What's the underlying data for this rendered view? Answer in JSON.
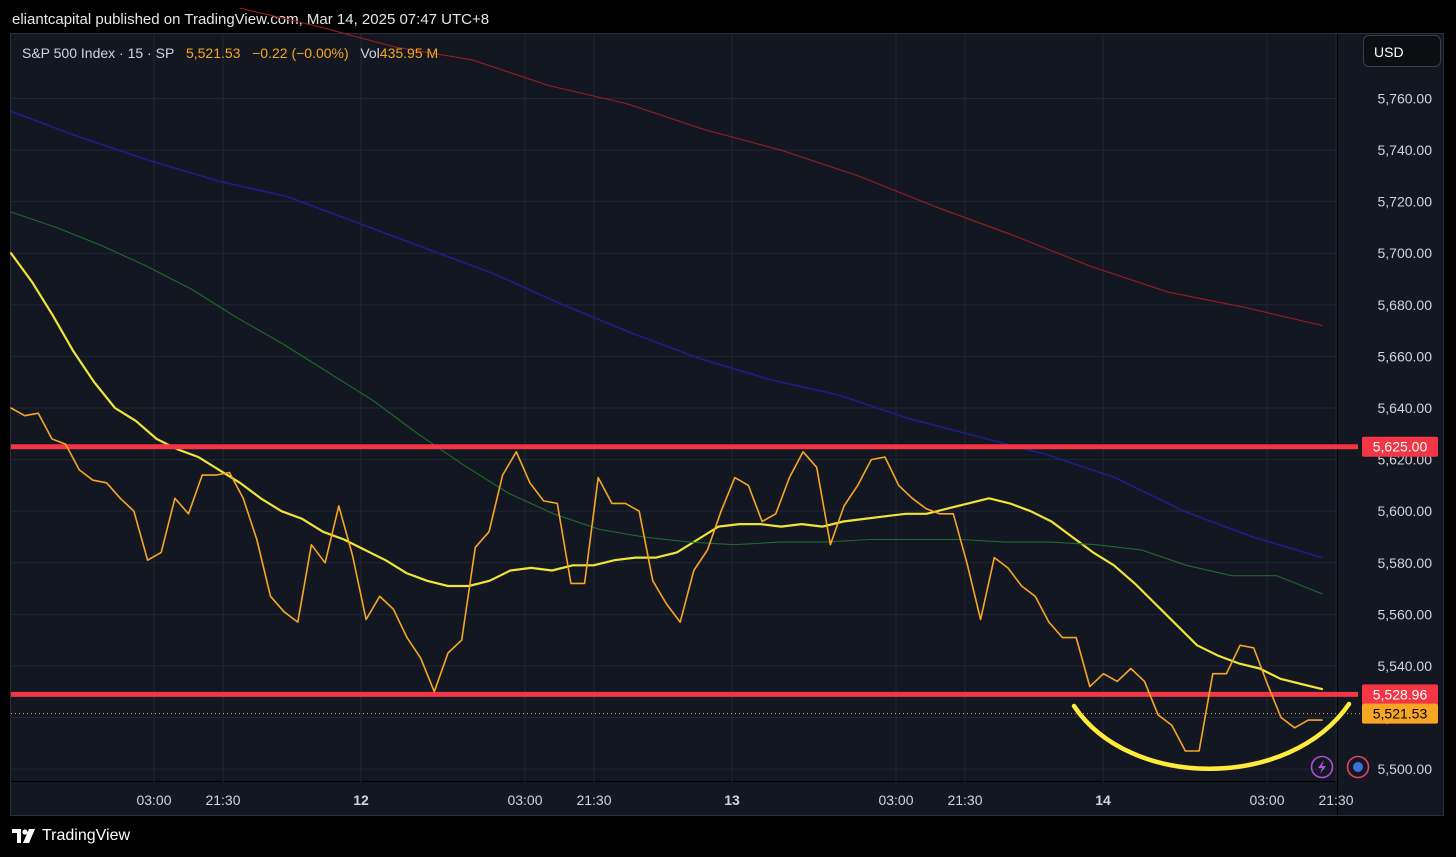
{
  "header": {
    "published_text": "eliantcapital published on TradingView.com, Mar 14, 2025 07:47 UTC+8"
  },
  "legend": {
    "symbol": "S&P 500 Index · 15 · SP",
    "last": "5,521.53",
    "change": "−0.22 (−0.00%)",
    "vol_label": "Vol",
    "vol_value": "435.95 M"
  },
  "currency_button": "USD",
  "footer": {
    "brand": "TradingView"
  },
  "colors": {
    "price": "#f6a623",
    "sma_yellow": "#f0e43a",
    "sma_green": "#1b6b2a",
    "sma_blue": "#1c1e8a",
    "sma_red": "#9b1d1d",
    "level": "#f23645",
    "annotation": "#ffeb3b"
  },
  "chart_data": {
    "type": "line",
    "x_ticks": [
      "03:00",
      "21:30",
      "12",
      "03:00",
      "21:30",
      "13",
      "03:00",
      "21:30",
      "14",
      "03:00",
      "21:30"
    ],
    "y_ticks": [
      "5,500.00",
      "5,520.00",
      "5,540.00",
      "5,560.00",
      "5,580.00",
      "5,600.00",
      "5,620.00",
      "5,640.00",
      "5,660.00",
      "5,680.00",
      "5,700.00",
      "5,720.00",
      "5,740.00",
      "5,760.00"
    ],
    "ylim": [
      5495,
      5785
    ],
    "grid": true,
    "horizontal_levels": [
      {
        "value": 5625.0,
        "label": "5,625.00"
      },
      {
        "value": 5528.96,
        "label": "5,528.96"
      }
    ],
    "last_price": {
      "value": 5521.53,
      "label": "5,521.53"
    },
    "series": [
      {
        "key": "price",
        "values": [
          5640,
          5637,
          5638,
          5628,
          5626,
          5616,
          5612,
          5611,
          5605,
          5600,
          5581,
          5584,
          5605,
          5599,
          5614,
          5614,
          5615,
          5605,
          5589,
          5567,
          5561,
          5557,
          5587,
          5580,
          5602,
          5583,
          5558,
          5567,
          5562,
          5551,
          5543,
          5530,
          5545,
          5550,
          5586,
          5592,
          5614,
          5623,
          5611,
          5604,
          5603,
          5572,
          5572,
          5613,
          5603,
          5603,
          5600,
          5573,
          5564,
          5557,
          5577,
          5585,
          5600,
          5613,
          5610,
          5596,
          5599,
          5613,
          5623,
          5617,
          5587,
          5602,
          5610,
          5620,
          5621,
          5610,
          5605,
          5601,
          5599,
          5599,
          5580,
          5558,
          5582,
          5578,
          5571,
          5567,
          5557,
          5551,
          5551,
          5532,
          5537,
          5534,
          5539,
          5534,
          5521,
          5517,
          5507,
          5507,
          5537,
          5537,
          5548,
          5547,
          5533,
          5520,
          5516,
          5519,
          5519
        ]
      },
      {
        "key": "sma_yellow",
        "values": [
          5700,
          5689,
          5676,
          5662,
          5650,
          5640,
          5635,
          5628,
          5624,
          5621,
          5616,
          5611,
          5605,
          5600,
          5597,
          5592,
          5589,
          5585,
          5581,
          5576,
          5573,
          5571,
          5571,
          5573,
          5577,
          5578,
          5577,
          5579,
          5579,
          5581,
          5582,
          5582,
          5584,
          5589,
          5594,
          5595,
          5595,
          5594,
          5595,
          5594,
          5596,
          5597,
          5598,
          5599,
          5599,
          5601,
          5603,
          5605,
          5603,
          5600,
          5596,
          5590,
          5584,
          5579,
          5572,
          5564,
          5556,
          5548,
          5544,
          5541,
          5539,
          5535,
          5533,
          5531
        ]
      },
      {
        "key": "sma_green",
        "values": [
          5716,
          5710,
          5703,
          5695,
          5686,
          5675,
          5665,
          5654,
          5643,
          5630,
          5618,
          5607,
          5599,
          5593,
          5590,
          5588,
          5587,
          5588,
          5588,
          5589,
          5589,
          5589,
          5588,
          5588,
          5587,
          5585,
          5579,
          5575,
          5575,
          5568
        ]
      },
      {
        "key": "sma_blue",
        "values": [
          5755,
          5745,
          5736,
          5728,
          5722,
          5712,
          5702,
          5692,
          5680,
          5669,
          5659,
          5651,
          5645,
          5636,
          5629,
          5622,
          5613,
          5600,
          5590,
          5582
        ]
      },
      {
        "key": "sma_red",
        "values": [
          5795,
          5788,
          5780,
          5775,
          5765,
          5758,
          5748,
          5740,
          5730,
          5718,
          5707,
          5695,
          5685,
          5679,
          5672
        ]
      }
    ]
  }
}
